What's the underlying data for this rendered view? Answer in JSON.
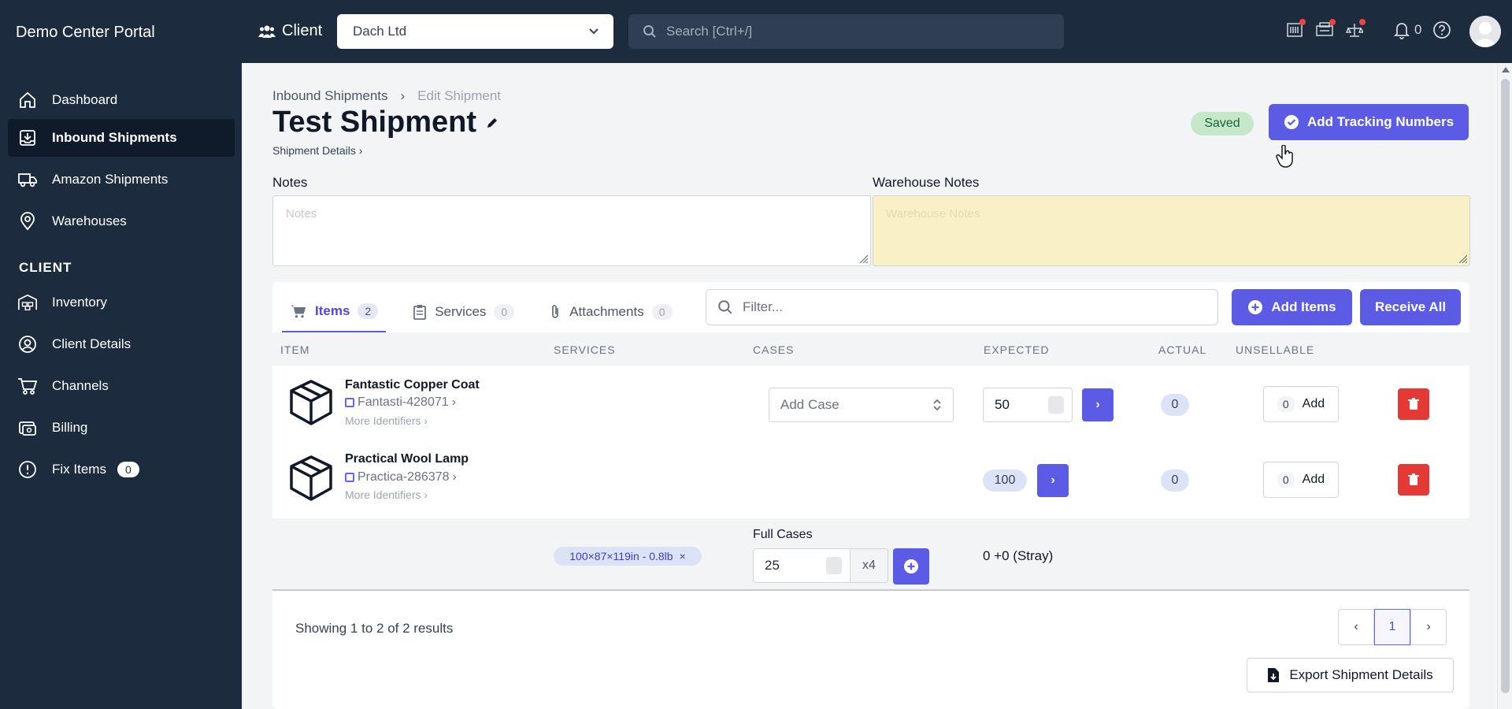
{
  "topbar": {
    "brand": "Demo Center Portal",
    "client_label": "Client",
    "client_value": "Dach Ltd",
    "search_placeholder": "Search [Ctrl+/]",
    "notification_count": "0"
  },
  "sidebar": {
    "items": [
      {
        "label": "Dashboard",
        "icon": "home-icon"
      },
      {
        "label": "Inbound Shipments",
        "icon": "inbox-download-icon"
      },
      {
        "label": "Amazon Shipments",
        "icon": "truck-icon"
      },
      {
        "label": "Warehouses",
        "icon": "map-pin-icon"
      }
    ],
    "section_label": "CLIENT",
    "client_items": [
      {
        "label": "Inventory",
        "icon": "warehouse-icon"
      },
      {
        "label": "Client Details",
        "icon": "user-circle-icon"
      },
      {
        "label": "Channels",
        "icon": "cart-icon"
      },
      {
        "label": "Billing",
        "icon": "billing-icon"
      },
      {
        "label": "Fix Items",
        "icon": "alert-circle-icon",
        "badge": "0"
      }
    ]
  },
  "page": {
    "breadcrumb": [
      "Inbound Shipments",
      "Edit Shipment"
    ],
    "title": "Test Shipment",
    "details_link": "Shipment Details",
    "saved": "Saved",
    "tracking_button": "Add Tracking Numbers",
    "notes_label": "Notes",
    "notes_placeholder": "Notes",
    "warehouse_notes_label": "Warehouse Notes",
    "warehouse_notes_placeholder": "Warehouse Notes"
  },
  "tabs": [
    {
      "label": "Items",
      "count": "2",
      "icon": "cart-icon"
    },
    {
      "label": "Services",
      "count": "0",
      "icon": "clipboard-icon"
    },
    {
      "label": "Attachments",
      "count": "0",
      "icon": "paperclip-icon"
    }
  ],
  "toolbar": {
    "filter_placeholder": "Filter...",
    "add_items": "Add Items",
    "receive_all": "Receive All"
  },
  "table": {
    "headers": [
      "ITEM",
      "SERVICES",
      "CASES",
      "EXPECTED",
      "ACTUAL",
      "UNSELLABLE"
    ],
    "rows": [
      {
        "name": "Fantastic Copper Coat",
        "sku": "Fantasti-428071",
        "more": "More Identifiers",
        "case_placeholder": "Add Case",
        "expected": "50",
        "actual": "0",
        "unsellable": "0",
        "add": "Add"
      },
      {
        "name": "Practical Wool Lamp",
        "sku": "Practica-286378",
        "more": "More Identifiers",
        "expected": "100",
        "actual": "0",
        "unsellable": "0",
        "add": "Add"
      }
    ],
    "case_row": {
      "dims": "100×87×119in - 0.8lb",
      "full_cases_label": "Full Cases",
      "full_cases_value": "25",
      "multiplier": "x4",
      "stray": "0 +0 (Stray)"
    }
  },
  "footer": {
    "showing": "Showing 1 to 2 of 2 results",
    "page": "1",
    "export": "Export Shipment Details"
  },
  "colors": {
    "sidebar_bg": "#1c2b3e",
    "accent": "#5b5be6",
    "danger": "#e53935",
    "saved_bg": "#c6e7c9",
    "warehouse_notes_bg": "#f9f1c5"
  }
}
